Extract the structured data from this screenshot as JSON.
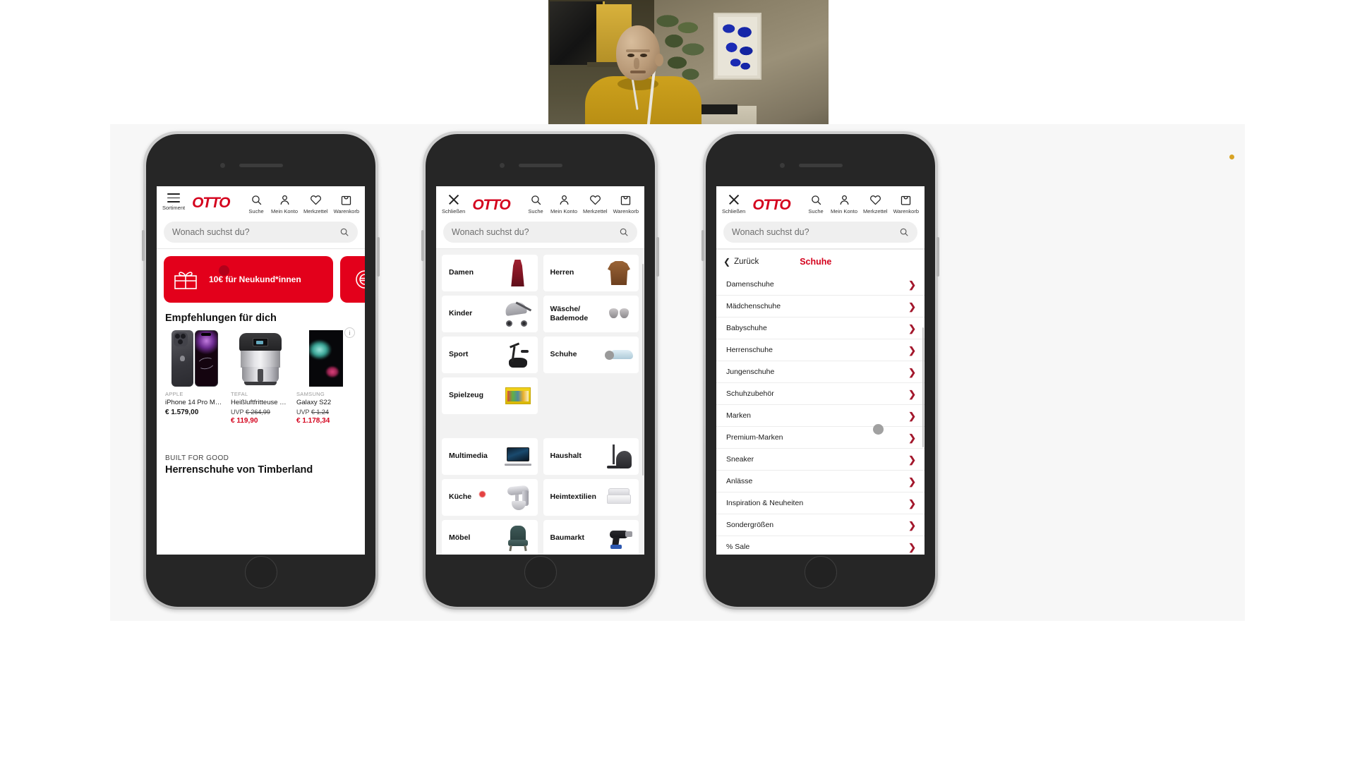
{
  "webcam": {
    "name": "presenter-webcam-feed"
  },
  "app": {
    "logo": "OTTO",
    "brand_color": "#d4021d",
    "accent_red": "#e3001b"
  },
  "search": {
    "placeholder": "Wonach suchst du?",
    "icon": "search-icon"
  },
  "phone1": {
    "header": {
      "menu_label": "Sortiment",
      "items": [
        {
          "label": "Suche",
          "icon": "search-icon"
        },
        {
          "label": "Mein Konto",
          "icon": "user-icon"
        },
        {
          "label": "Merkzettel",
          "icon": "heart-icon"
        },
        {
          "label": "Warenkorb",
          "icon": "shopping-bag-icon"
        }
      ]
    },
    "promos": [
      {
        "text": "10€ für Neukund*innen",
        "icon": "gift-icon"
      },
      {
        "text": "",
        "icon": "euro-circle-icon"
      }
    ],
    "info_badge": "i",
    "section_title": "Empfehlungen für dich",
    "products": [
      {
        "brand": "APPLE",
        "name": "iPhone 14 Pro Max ...",
        "price": "€ 1.579,00",
        "uvp_label": "",
        "uvp_value": "",
        "sale_price": ""
      },
      {
        "brand": "TEFAL",
        "name": "Heißluftfritteuse E...",
        "price": "",
        "uvp_label": "UVP",
        "uvp_value": "€ 264,99",
        "sale_price": "€ 119,90"
      },
      {
        "brand": "SAMSUNG",
        "name": "Galaxy S22",
        "price": "",
        "uvp_label": "UVP",
        "uvp_value": "€ 1.24",
        "sale_price": "€ 1.178,34"
      }
    ],
    "footer_block": {
      "kicker": "BUILT FOR GOOD",
      "title": "Herrenschuhe von Timberland"
    }
  },
  "phone2": {
    "header": {
      "close_label": "Schließen",
      "items": [
        {
          "label": "Suche",
          "icon": "search-icon"
        },
        {
          "label": "Mein Konto",
          "icon": "user-icon"
        },
        {
          "label": "Merkzettel",
          "icon": "heart-icon"
        },
        {
          "label": "Warenkorb",
          "icon": "shopping-bag-icon"
        }
      ]
    },
    "categories_top": [
      {
        "label": "Damen",
        "art": "dress-art"
      },
      {
        "label": "Herren",
        "art": "jacket-art"
      },
      {
        "label": "Kinder",
        "art": "stroller-art"
      },
      {
        "label": "Wäsche/\nBademode",
        "art": "bra-art"
      },
      {
        "label": "Sport",
        "art": "exercise-bike-art"
      },
      {
        "label": "Schuhe",
        "art": "shoe-art"
      },
      {
        "label": "Spielzeug",
        "art": "lego-art"
      }
    ],
    "categories_bottom": [
      {
        "label": "Multimedia",
        "art": "laptop-art"
      },
      {
        "label": "Haushalt",
        "art": "vacuum-art"
      },
      {
        "label": "Küche",
        "art": "stand-mixer-art"
      },
      {
        "label": "Heimtextilien",
        "art": "bed-art"
      },
      {
        "label": "Möbel",
        "art": "armchair-art"
      },
      {
        "label": "Baumarkt",
        "art": "drill-art"
      }
    ]
  },
  "phone3": {
    "header": {
      "close_label": "Schließen",
      "items": [
        {
          "label": "Suche",
          "icon": "search-icon"
        },
        {
          "label": "Mein Konto",
          "icon": "user-icon"
        },
        {
          "label": "Merkzettel",
          "icon": "heart-icon"
        },
        {
          "label": "Warenkorb",
          "icon": "shopping-bag-icon"
        }
      ]
    },
    "breadcrumb": {
      "back_label": "Zurück",
      "title": "Schuhe"
    },
    "list_items": [
      "Damenschuhe",
      "Mädchenschuhe",
      "Babyschuhe",
      "Herrenschuhe",
      "Jungenschuhe",
      "Schuhzubehör",
      "Marken",
      "Premium-Marken",
      "Sneaker",
      "Anlässe",
      "Inspiration & Neuheiten",
      "Sondergrößen",
      "% Sale"
    ]
  }
}
